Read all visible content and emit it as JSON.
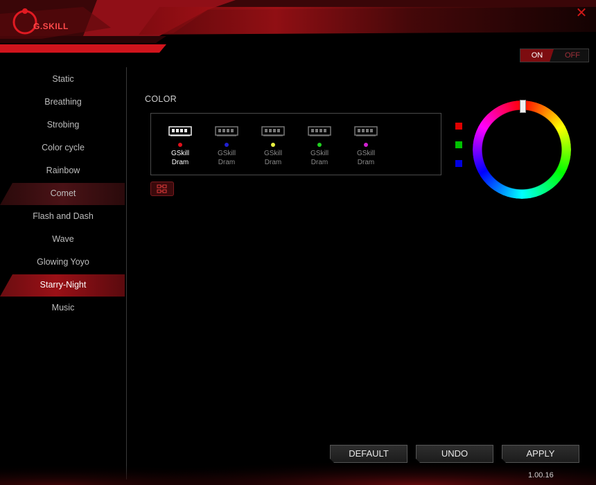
{
  "brand": {
    "logo_text": "G.SKILL"
  },
  "toggle": {
    "on_label": "ON",
    "off_label": "OFF",
    "state": "on"
  },
  "sidebar": {
    "items": [
      {
        "label": "Static",
        "state": "normal"
      },
      {
        "label": "Breathing",
        "state": "normal"
      },
      {
        "label": "Strobing",
        "state": "normal"
      },
      {
        "label": "Color cycle",
        "state": "normal"
      },
      {
        "label": "Rainbow",
        "state": "normal"
      },
      {
        "label": "Comet",
        "state": "hover"
      },
      {
        "label": "Flash and Dash",
        "state": "normal"
      },
      {
        "label": "Wave",
        "state": "normal"
      },
      {
        "label": "Glowing Yoyo",
        "state": "normal"
      },
      {
        "label": "Starry-Night",
        "state": "selected"
      },
      {
        "label": "Music",
        "state": "normal"
      }
    ]
  },
  "main": {
    "color_label": "COLOR",
    "drams": [
      {
        "line1": "GSkill",
        "line2": "Dram",
        "dot_color": "#e0101a",
        "selected": true
      },
      {
        "line1": "GSkill",
        "line2": "Dram",
        "dot_color": "#2020d0",
        "selected": false
      },
      {
        "line1": "GSkill",
        "line2": "Dram",
        "dot_color": "#e8f040",
        "selected": false
      },
      {
        "line1": "GSkill",
        "line2": "Dram",
        "dot_color": "#20d020",
        "selected": false
      },
      {
        "line1": "GSkill",
        "line2": "Dram",
        "dot_color": "#d020d0",
        "selected": false
      }
    ],
    "color_swatches": [
      "#e00000",
      "#00c000",
      "#0000e0"
    ]
  },
  "buttons": {
    "default_label": "DEFAULT",
    "undo_label": "UNDO",
    "apply_label": "APPLY"
  },
  "version": "1.00.16",
  "colors": {
    "accent": "#b01218",
    "background": "#000000"
  }
}
